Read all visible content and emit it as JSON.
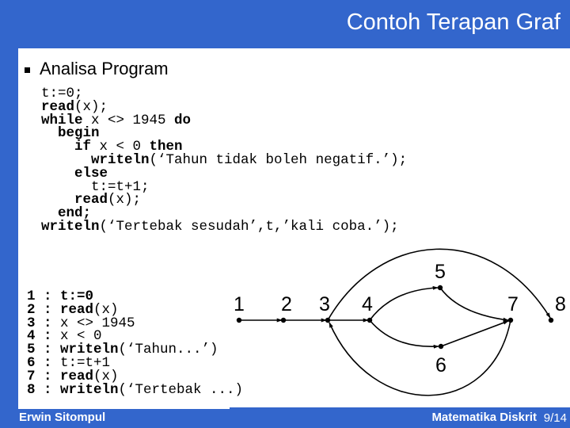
{
  "header": {
    "title": "Contoh Terapan Graf"
  },
  "section": {
    "bullet_heading": "Analisa Program"
  },
  "program": [
    [
      {
        "t": "t:=0;",
        "b": false
      }
    ],
    [
      {
        "t": "read",
        "b": true
      },
      {
        "t": "(x);",
        "b": false
      }
    ],
    [
      {
        "t": "while",
        "b": true
      },
      {
        "t": " x <> 1945 ",
        "b": false
      },
      {
        "t": "do",
        "b": true
      }
    ],
    [
      {
        "t": "  begin",
        "b": true
      }
    ],
    [
      {
        "t": "    if",
        "b": true
      },
      {
        "t": " x < 0 ",
        "b": false
      },
      {
        "t": "then",
        "b": true
      }
    ],
    [
      {
        "t": "      writeln",
        "b": true
      },
      {
        "t": "(‘Tahun tidak boleh negatif.’);",
        "b": false
      }
    ],
    [
      {
        "t": "    else",
        "b": true
      }
    ],
    [
      {
        "t": "      t:=t+1;",
        "b": false
      }
    ],
    [
      {
        "t": "    read",
        "b": true
      },
      {
        "t": "(x);",
        "b": false
      }
    ],
    [
      {
        "t": "  end;",
        "b": true
      }
    ],
    [
      {
        "t": "writeln",
        "b": true
      },
      {
        "t": "(‘Tertebak sesudah’,t,’kali coba.’);",
        "b": false
      }
    ]
  ],
  "statements": [
    {
      "num": "1",
      "sep": " : ",
      "parts": [
        {
          "t": "t:=0",
          "b": true
        }
      ]
    },
    {
      "num": "2",
      "sep": " : ",
      "parts": [
        {
          "t": "read",
          "b": true
        },
        {
          "t": "(x)",
          "b": false
        }
      ]
    },
    {
      "num": "3",
      "sep": " : ",
      "parts": [
        {
          "t": "x <> 1945",
          "b": false
        }
      ]
    },
    {
      "num": "4",
      "sep": " : ",
      "parts": [
        {
          "t": "x < 0",
          "b": false
        }
      ]
    },
    {
      "num": "5",
      "sep": " : ",
      "parts": [
        {
          "t": "writeln",
          "b": true
        },
        {
          "t": "(‘Tahun...’)",
          "b": false
        }
      ]
    },
    {
      "num": "6",
      "sep": " : ",
      "parts": [
        {
          "t": "t:=t+1",
          "b": false
        }
      ]
    },
    {
      "num": "7",
      "sep": " : ",
      "parts": [
        {
          "t": "read",
          "b": true
        },
        {
          "t": "(x)",
          "b": false
        }
      ]
    },
    {
      "num": "8",
      "sep": " : ",
      "parts": [
        {
          "t": "writeln",
          "b": true
        },
        {
          "t": "(‘Tertebak ...)",
          "b": false
        }
      ]
    }
  ],
  "graph": {
    "nodes": [
      "1",
      "2",
      "3",
      "4",
      "5",
      "6",
      "7",
      "8"
    ],
    "edges": [
      [
        "1",
        "2"
      ],
      [
        "2",
        "3"
      ],
      [
        "3",
        "4"
      ],
      [
        "4",
        "5"
      ],
      [
        "4",
        "6"
      ],
      [
        "5",
        "7"
      ],
      [
        "6",
        "7"
      ],
      [
        "7",
        "3"
      ],
      [
        "3",
        "8"
      ]
    ]
  },
  "footer": {
    "author": "Erwin Sitompul",
    "course": "Matematika Diskrit",
    "page": "9/14"
  }
}
